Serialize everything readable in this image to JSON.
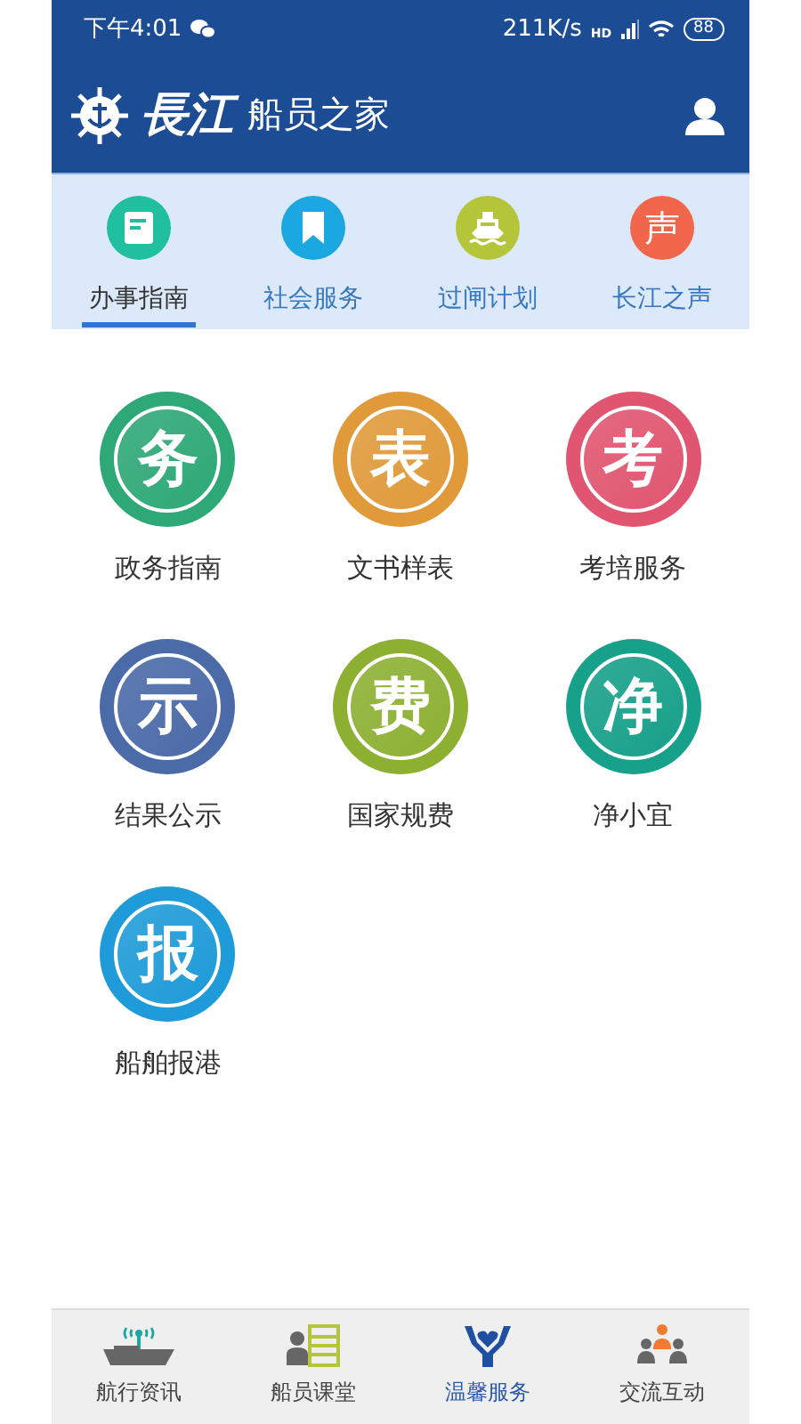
{
  "status_bar": {
    "time": "下午4:01",
    "speed": "211K/s",
    "network": "HD",
    "battery": "88"
  },
  "header": {
    "logo_main": "長江",
    "logo_sub": "船员之家"
  },
  "tabs": [
    {
      "label": "办事指南",
      "selected": true,
      "color": "#1fbf9f"
    },
    {
      "label": "社会服务",
      "selected": false,
      "color": "#1ba8e0"
    },
    {
      "label": "过闸计划",
      "selected": false,
      "color": "#b5c53a"
    },
    {
      "label": "长江之声",
      "glyph": "声",
      "selected": false,
      "color": "#f2664c"
    }
  ],
  "services": [
    {
      "glyph": "务",
      "label": "政务指南",
      "color": "#2ea877"
    },
    {
      "glyph": "表",
      "label": "文书样表",
      "color": "#e09a3a"
    },
    {
      "glyph": "考",
      "label": "考培服务",
      "color": "#e05670"
    },
    {
      "glyph": "示",
      "label": "结果公示",
      "color": "#4a6aa8"
    },
    {
      "glyph": "费",
      "label": "国家规费",
      "color": "#8db033"
    },
    {
      "glyph": "净",
      "label": "净小宜",
      "color": "#17a08a"
    },
    {
      "glyph": "报",
      "label": "船舶报港",
      "color": "#1e9bd8"
    }
  ],
  "bottom_nav": [
    {
      "label": "航行资讯",
      "selected": false
    },
    {
      "label": "船员课堂",
      "selected": false
    },
    {
      "label": "温馨服务",
      "selected": true
    },
    {
      "label": "交流互动",
      "selected": false
    }
  ]
}
